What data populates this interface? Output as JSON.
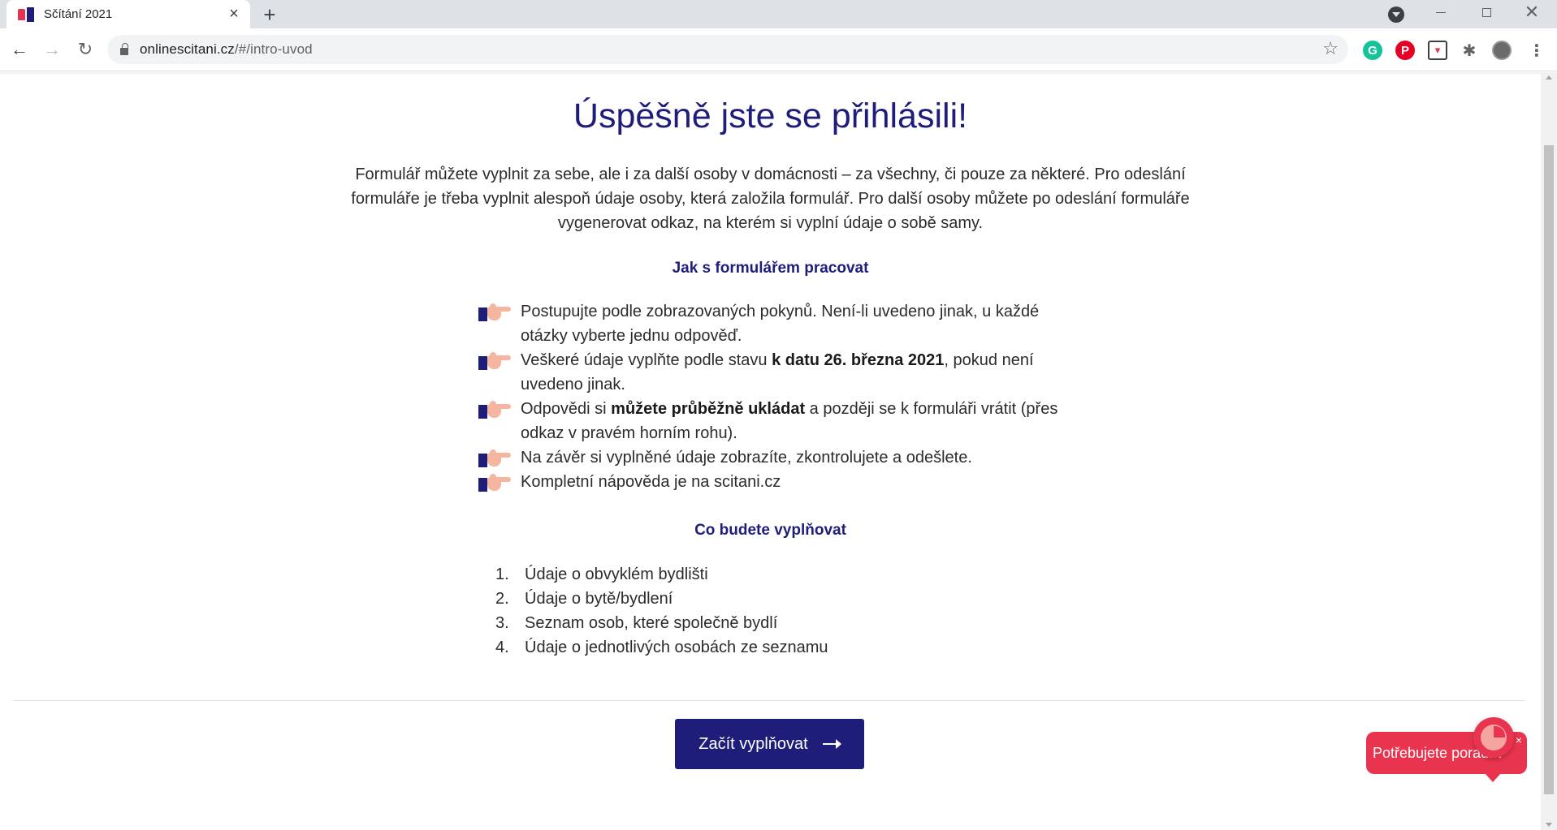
{
  "browser": {
    "tab_title": "Sčítání 2021",
    "tab_close": "×",
    "new_tab": "+",
    "url_host": "onlinescitani.cz",
    "url_path": "/#/intro-uvod",
    "extensions": [
      "grammarly-icon",
      "pinterest-icon",
      "pocket-icon",
      "puzzle-icon",
      "profile-avatar",
      "menu-icon"
    ],
    "ext_labels": {
      "grammarly": "G",
      "pinterest": "P",
      "pocket": "▾",
      "puzzle": "✱",
      "menu": "⋮"
    }
  },
  "page": {
    "title": "Úspěšně jste se přihlásili!",
    "intro": "Formulář můžete vyplnit za sebe, ale i za další osoby v domácnosti – za všechny, či pouze za některé. Pro odeslání formuláře je třeba vyplnit alespoň údaje osoby, která založila formulář. Pro další osoby můžete po odeslání formuláře vygenerovat odkaz, na kterém si vyplní údaje o sobě samy.",
    "how_heading": "Jak s formulářem pracovat",
    "tips": [
      {
        "before": "Postupujte podle zobrazovaných pokynů. Není-li uvedeno jinak, u každé otázky vyberte jednu odpověď.",
        "bold": "",
        "after": ""
      },
      {
        "before": "Veškeré údaje vyplňte podle stavu ",
        "bold": "k datu 26. března 2021",
        "after": ", pokud není uvedeno jinak."
      },
      {
        "before": "Odpovědi si ",
        "bold": "můžete průběžně ukládat",
        "after": " a později se k formuláři vrátit (přes odkaz v pravém horním rohu)."
      },
      {
        "before": "Na závěr si vyplněné údaje zobrazíte, zkontrolujete a odešlete.",
        "bold": "",
        "after": ""
      },
      {
        "before": "Kompletní nápověda je na scitani.cz",
        "bold": "",
        "after": ""
      }
    ],
    "what_heading": "Co budete vyplňovat",
    "steps": [
      {
        "num": "1.",
        "label": "Údaje o obvyklém bydlišti"
      },
      {
        "num": "2.",
        "label": "Údaje o bytě/bydlení"
      },
      {
        "num": "3.",
        "label": "Seznam osob, které společně bydlí"
      },
      {
        "num": "4.",
        "label": "Údaje o jednotlivých osobách ze seznamu"
      }
    ],
    "start_button": "Začít vyplňovat",
    "help_bubble": "Potřebujete poradit?",
    "help_close": "×"
  },
  "colors": {
    "brand_navy": "#1f1d7a",
    "accent_red": "#e8344e",
    "hand_skin": "#f5b6a1"
  }
}
